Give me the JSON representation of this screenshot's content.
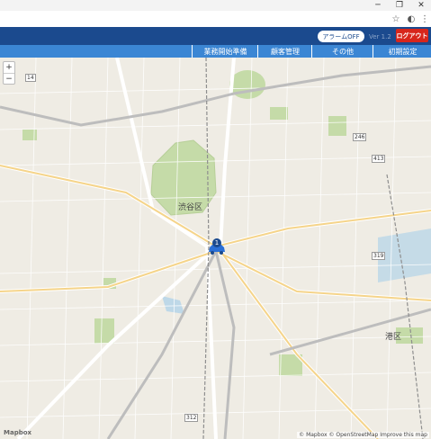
{
  "browser": {
    "window_buttons": {
      "minimize": "─",
      "restore": "❐",
      "close": "✕"
    },
    "star_icon": "☆",
    "menu_icon": "⋮",
    "ext_icon": "◐"
  },
  "header": {
    "alarm_button": "アラームOFF",
    "version": "Ver 1.2",
    "logout_button": "ログアウト",
    "colors": {
      "app_bar": "#1b4a8e",
      "menu_bar": "#3b86d4",
      "logout": "#d7261c"
    }
  },
  "menu": {
    "items": [
      "業務開始準備",
      "顧客管理",
      "その他",
      "初期設定"
    ]
  },
  "map": {
    "zoom_in": "+",
    "zoom_out": "−",
    "district_labels": [
      "渋谷区",
      "港区"
    ],
    "marker_count": "1",
    "road_badges": [
      "14",
      "246",
      "413",
      "319",
      "312"
    ],
    "attribution": "© Mapbox © OpenStreetMap Improve this map",
    "logo": "Mapbox"
  }
}
